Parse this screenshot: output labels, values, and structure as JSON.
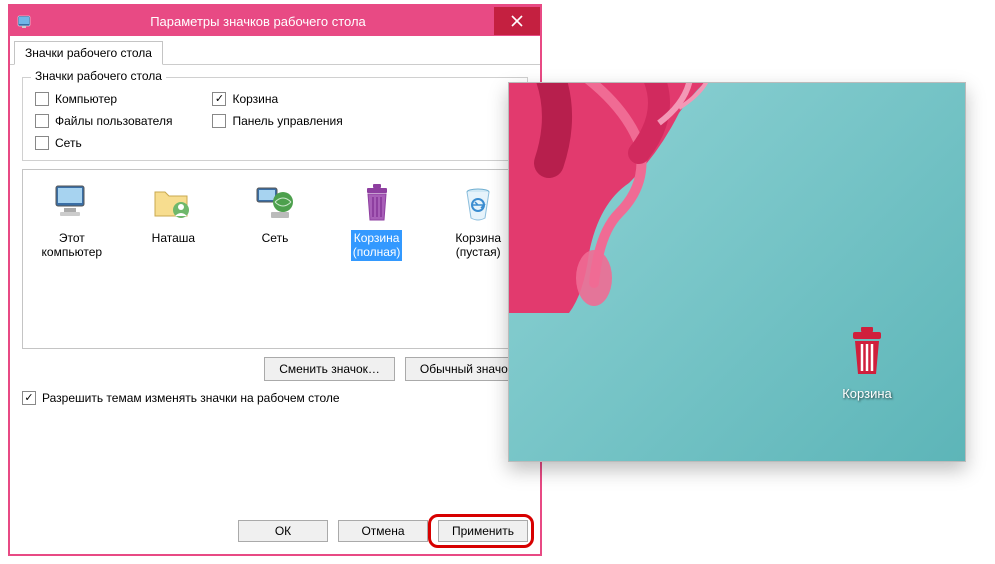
{
  "window": {
    "title": "Параметры значков рабочего стола"
  },
  "tab": {
    "label": "Значки рабочего стола"
  },
  "groupbox": {
    "title": "Значки рабочего стола",
    "checks": {
      "computer": {
        "label": "Компьютер",
        "checked": false
      },
      "userfiles": {
        "label": "Файлы пользователя",
        "checked": false
      },
      "network": {
        "label": "Сеть",
        "checked": false
      },
      "recycle": {
        "label": "Корзина",
        "checked": true
      },
      "controlpanel": {
        "label": "Панель управления",
        "checked": false
      }
    }
  },
  "icons": {
    "this_computer": {
      "line1": "Этот",
      "line2": "компьютер"
    },
    "user": {
      "line1": "Наташа"
    },
    "network": {
      "line1": "Сеть"
    },
    "recycle_full": {
      "line1": "Корзина",
      "line2": "(полная)"
    },
    "recycle_empty": {
      "line1": "Корзина",
      "line2": "(пустая)"
    }
  },
  "buttons": {
    "change_icon": "Сменить значок…",
    "restore_default": "Обычный значок",
    "ok": "ОК",
    "cancel": "Отмена",
    "apply": "Применить"
  },
  "allow_themes": {
    "label": "Разрешить темам изменять значки на рабочем столе",
    "checked": true
  },
  "desktop": {
    "recycle_label": "Корзина"
  },
  "colors": {
    "accent": "#e84a84",
    "close_bg": "#c42040",
    "selection": "#3399ff",
    "highlight_ring": "#d70000",
    "trash_red": "#d01f3c",
    "trash_purple": "#8e3fa0"
  }
}
